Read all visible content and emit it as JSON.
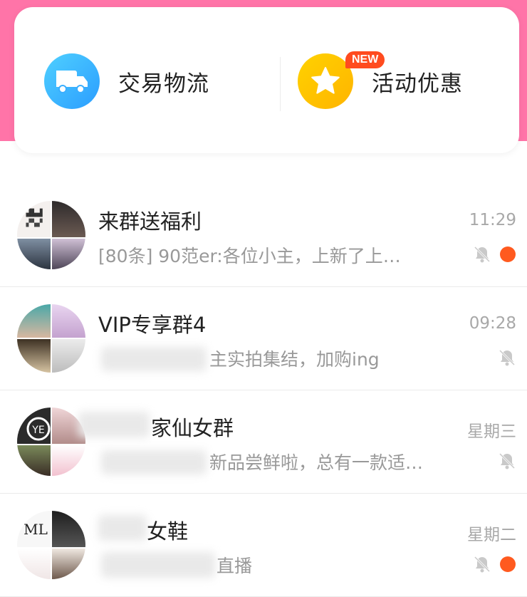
{
  "top_entries": {
    "logistics": {
      "label": "交易物流",
      "icon": "truck-icon"
    },
    "promotions": {
      "label": "活动优惠",
      "icon": "star-icon",
      "badge": "NEW"
    }
  },
  "conversations": [
    {
      "title": "来群送福利",
      "preview": "[80条] 90范er:各位小主，上新了上…",
      "time": "11:29",
      "muted": true,
      "unread": true
    },
    {
      "title": "VIP专享群4",
      "preview": "主实拍集结，加购ing",
      "time": "09:28",
      "muted": true,
      "unread": false
    },
    {
      "title": "家仙女群",
      "preview": "新品尝鲜啦，总有一款适…",
      "time": "星期三",
      "muted": true,
      "unread": false
    },
    {
      "title": "女鞋",
      "preview": "直播",
      "time": "星期二",
      "muted": true,
      "unread": true
    }
  ],
  "colors": {
    "header_pink": "#ff74a8",
    "unread": "#ff5a1f",
    "badge": "#ff4b1f"
  }
}
